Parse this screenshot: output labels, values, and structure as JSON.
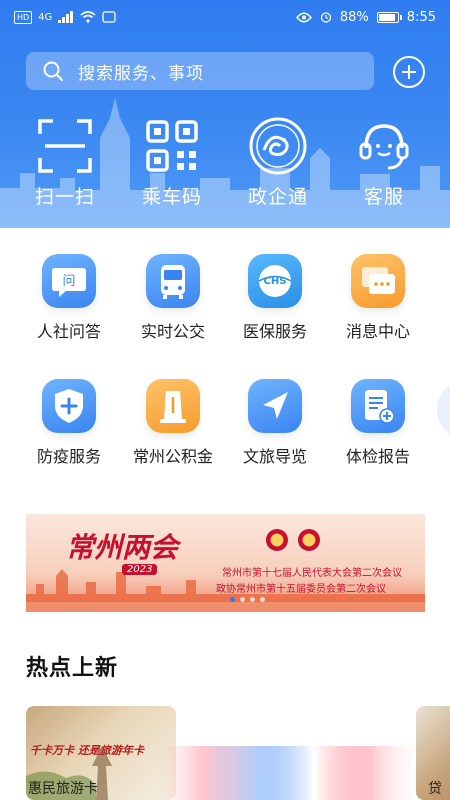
{
  "status_bar": {
    "left_badge": "HD",
    "network": "4G",
    "battery": "88%",
    "time": "8:55"
  },
  "search": {
    "placeholder": "搜索服务、事项"
  },
  "quick_actions": [
    {
      "label": "扫一扫",
      "icon": "scan-icon"
    },
    {
      "label": "乘车码",
      "icon": "qr-code-icon"
    },
    {
      "label": "政企通",
      "icon": "dragon-emblem-icon"
    },
    {
      "label": "客服",
      "icon": "headset-icon"
    }
  ],
  "services": [
    {
      "label": "人社问答",
      "icon": "chat-question-icon"
    },
    {
      "label": "实时公交",
      "icon": "bus-icon"
    },
    {
      "label": "医保服务",
      "icon": "chs-icon",
      "icon_text": "CHS"
    },
    {
      "label": "消息中心",
      "icon": "message-icon"
    },
    {
      "label": "防疫服务",
      "icon": "shield-plus-icon"
    },
    {
      "label": "常州公积金",
      "icon": "fund-icon"
    },
    {
      "label": "文旅导览",
      "icon": "navigation-arrow-icon"
    },
    {
      "label": "体检报告",
      "icon": "report-icon"
    }
  ],
  "banner": {
    "title": "常州两会",
    "year": "2023",
    "line1": "常州市第十七届人民代表大会第二次会议",
    "line2": "政协常州市第十五届委员会第二次会议",
    "colors": {
      "primary": "#c8102e",
      "background": "#fbe7dc"
    }
  },
  "hot_section": {
    "title": "热点上新",
    "cards": [
      {
        "label": "惠民旅游卡",
        "caption": "千卡万卡 还是旅游年卡"
      },
      {
        "label": "贷"
      }
    ]
  },
  "colors": {
    "header_blue": "#2f7cf0",
    "text_dark": "#222222"
  }
}
